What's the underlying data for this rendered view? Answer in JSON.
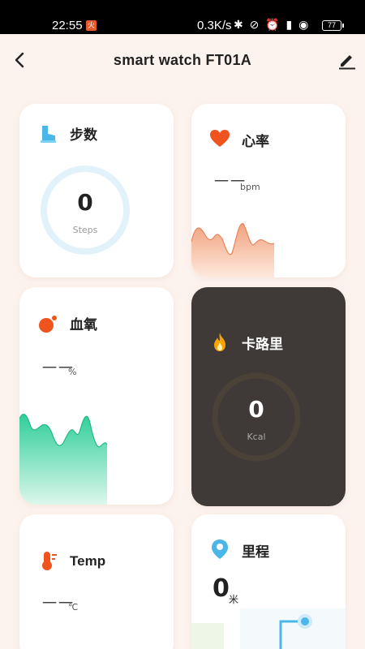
{
  "status": {
    "time": "22:55",
    "badge": "火",
    "speed": "0.3K/s",
    "icons": "✱ ⊘ ⏰ ▮ ◉",
    "battery": "77"
  },
  "header": {
    "title": "smart watch   FT01A"
  },
  "cards": {
    "steps": {
      "title": "步数",
      "value": "0",
      "unit": "Steps"
    },
    "heart": {
      "title": "心率",
      "value": "一一",
      "unit": "bpm"
    },
    "oxygen": {
      "title": "血氧",
      "value": "一一",
      "unit": "%"
    },
    "calories": {
      "title": "卡路里",
      "value": "0",
      "unit": "Kcal"
    },
    "temp": {
      "title": "Temp",
      "value": "一一",
      "unit": "℃"
    },
    "distance": {
      "title": "里程",
      "value": "0",
      "unit": "米"
    }
  },
  "colors": {
    "heart": "#f0541e",
    "oxygen": "#f0541e",
    "steps": "#4bb7e8",
    "wave_heart": "#f2a27f",
    "wave_oxygen": "#2fcf9a",
    "calories_icon": "#f7a400",
    "dark_card": "#3f3a38"
  },
  "icons": {
    "back": "back-arrow-icon",
    "edit": "pencil-icon",
    "steps": "shoe-icon",
    "heart": "heart-icon",
    "oxygen": "oxygen-icon",
    "calories": "flame-icon",
    "temp": "thermometer-icon",
    "distance": "location-pin-icon"
  }
}
